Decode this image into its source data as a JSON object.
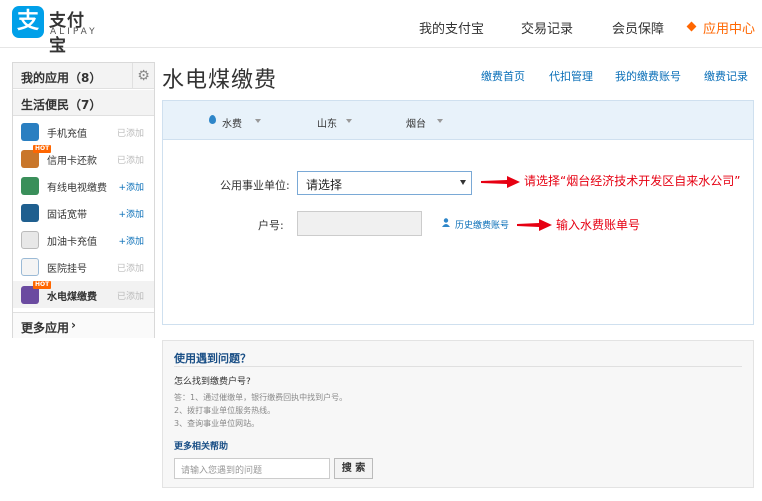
{
  "header": {
    "logo_cn": "支付宝",
    "logo_en": "ALIPAY",
    "logo_mark": "支",
    "nav": [
      "我的支付宝",
      "交易记录",
      "会员保障",
      "应用中心"
    ]
  },
  "sidebar": {
    "my_apps_title": "我的应用（8）",
    "group_title": "生活便民（7）",
    "hot_badge": "HOT",
    "items": [
      {
        "label": "手机充值",
        "action": "已添加",
        "icon": "phone-icon"
      },
      {
        "label": "信用卡还款",
        "action": "已添加",
        "icon": "credit-card-icon"
      },
      {
        "label": "有线电视缴费",
        "action": "+添加",
        "icon": "tv-icon"
      },
      {
        "label": "固话宽带",
        "action": "+添加",
        "icon": "landline-icon"
      },
      {
        "label": "加油卡充值",
        "action": "+添加",
        "icon": "fuel-icon"
      },
      {
        "label": "医院挂号",
        "action": "已添加",
        "icon": "hospital-icon"
      },
      {
        "label": "水电煤缴费",
        "action": "已添加",
        "icon": "utility-icon"
      }
    ],
    "more_label": "更多应用"
  },
  "main": {
    "title": "水电煤缴费",
    "sublinks": [
      "缴费首页",
      "代扣管理",
      "我的缴费账号",
      "缴费记录"
    ],
    "filters": {
      "type": "水费",
      "province": "山东",
      "city": "烟台"
    },
    "form": {
      "unit_label": "公用事业单位:",
      "unit_value": "请选择",
      "account_label": "户号:",
      "history_link": "历史缴费账号"
    },
    "annotations": {
      "unit_hint": "请选择“烟台经济技术开发区自来水公司”",
      "account_hint": "输入水费账单号"
    }
  },
  "help": {
    "title": "使用遇到问题？",
    "question": "怎么找到缴费户号?",
    "answers": [
      "答：1、通过催缴单，银行缴费回执中找到户号。",
      "2、拨打事业单位服务热线。",
      "3、查询事业单位网站。"
    ],
    "more_title": "更多相关帮助",
    "search_placeholder": "请输入您遇到的问题",
    "search_button": "搜 索"
  },
  "colors": {
    "accent": "#ff6600",
    "link": "#0a6fb8",
    "brand": "#00a0e9",
    "annotation": "#e60012"
  }
}
